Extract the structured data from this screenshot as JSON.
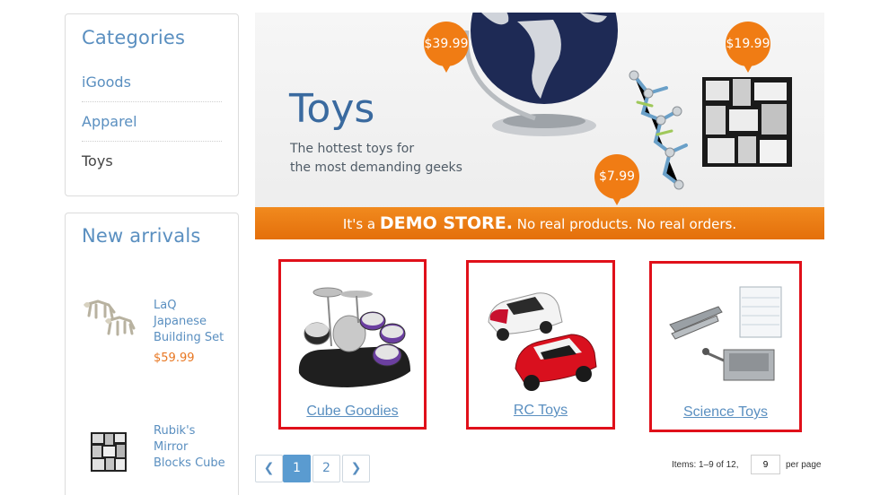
{
  "sidebar": {
    "categories_title": "Categories",
    "categories": [
      {
        "label": "iGoods"
      },
      {
        "label": "Apparel"
      },
      {
        "label": "Toys"
      }
    ],
    "new_arrivals_title": "New arrivals",
    "new_arrivals": [
      {
        "name": "LaQ Japanese Building Set",
        "price": "$59.99"
      },
      {
        "name": "Rubik's Mirror Blocks Cube"
      }
    ]
  },
  "banner": {
    "title": "Toys",
    "subtitle_line1": "The hottest toys for",
    "subtitle_line2": "the most demanding geeks",
    "prices": [
      "$39.99",
      "$19.99",
      "$7.99"
    ],
    "strip_prefix": "It's a",
    "strip_big": "DEMO STORE.",
    "strip_suffix": "No real products. No real orders."
  },
  "subcategories": [
    {
      "label": "Cube Goodies"
    },
    {
      "label": "RC Toys"
    },
    {
      "label": "Science Toys"
    }
  ],
  "pager": {
    "prev_icon": "chevron-left-icon",
    "next_icon": "chevron-right-icon",
    "pages": [
      "1",
      "2"
    ],
    "current": "1",
    "items_info": "Items: 1–9 of 12,",
    "per_page_value": "9",
    "per_page_label": "per page"
  },
  "colors": {
    "link": "#5a8fc0",
    "accent": "#f07c14",
    "highlight_border": "#e0101a",
    "price": "#e87722"
  }
}
